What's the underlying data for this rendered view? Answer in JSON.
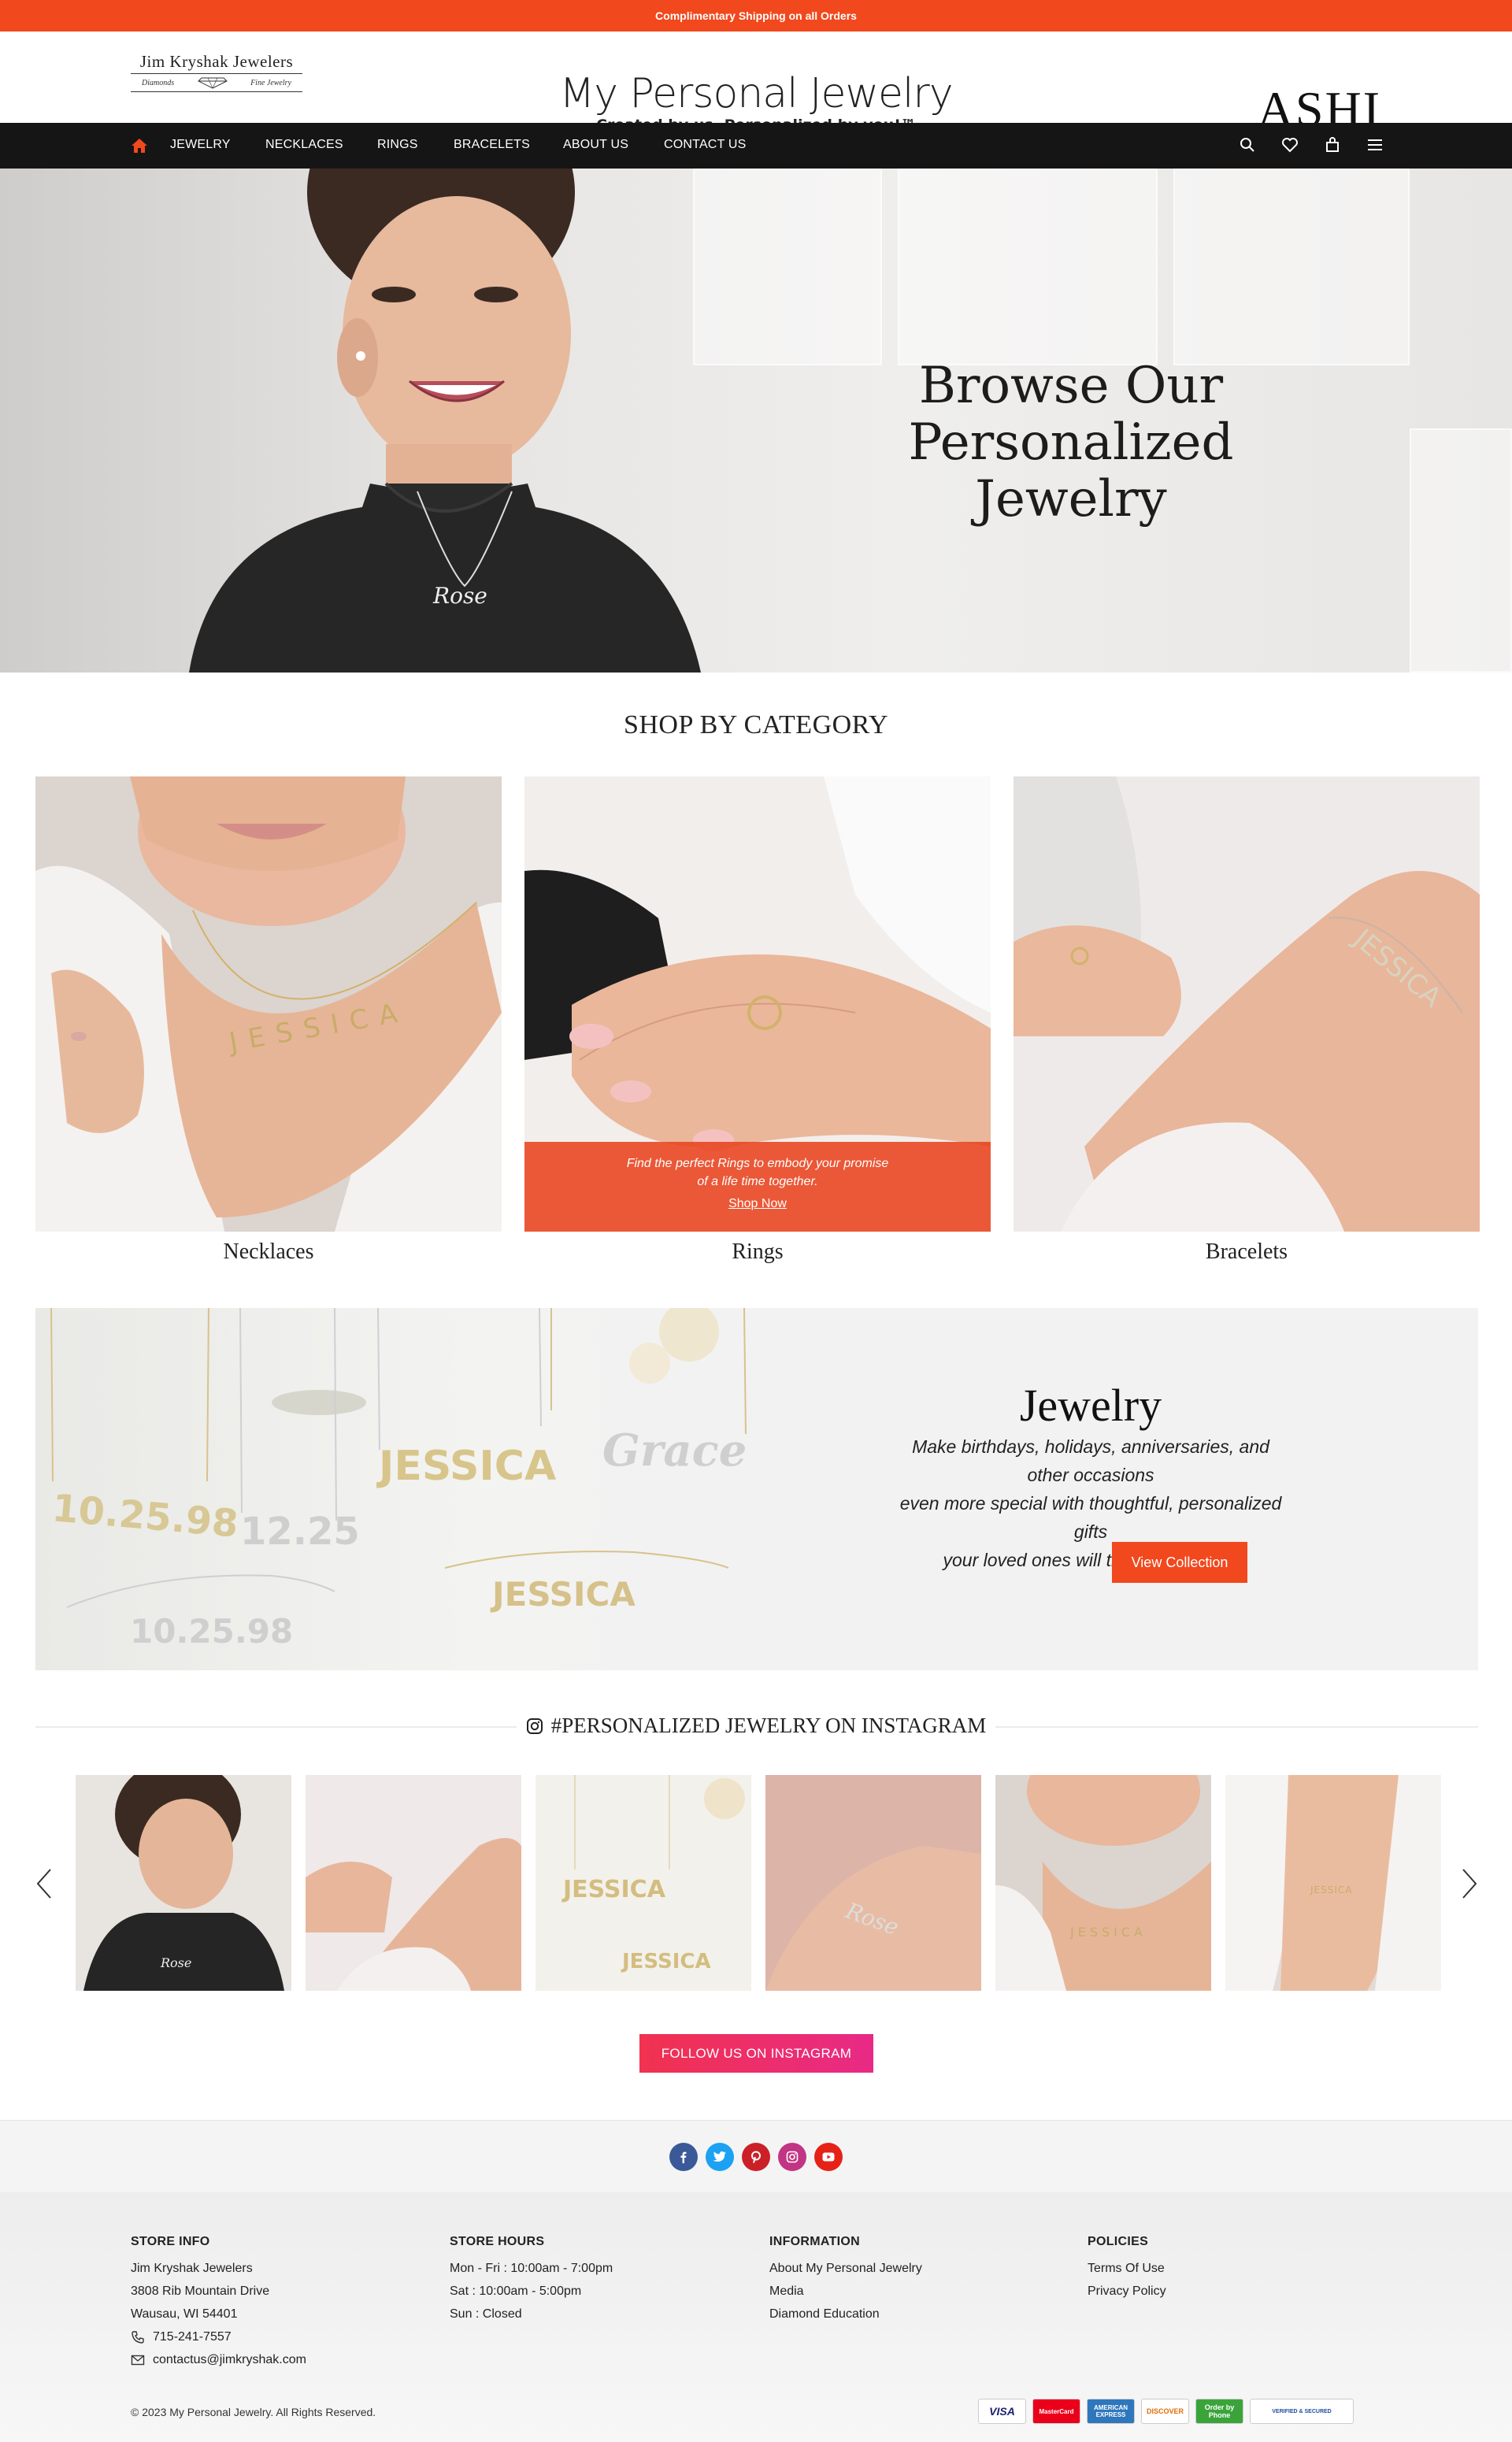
{
  "promo": {
    "text": "Complimentary Shipping on all Orders"
  },
  "header": {
    "jk_logo": {
      "name": "Jim Kryshak Jewelers",
      "left_sub": "Diamonds",
      "right_sub": "Fine Jewelry"
    },
    "mpj_logo": {
      "title": "My Personal Jewelry",
      "tagline": "Created by us, Personalized by you!™"
    },
    "ashi_logo": "ASHI"
  },
  "nav": {
    "items": [
      "JEWELRY",
      "NECKLACES",
      "RINGS",
      "BRACELETS",
      "ABOUT US",
      "CONTACT US"
    ],
    "icons": [
      "search-icon",
      "heart-icon",
      "bag-icon",
      "menu-icon"
    ]
  },
  "hero": {
    "title_line1": "Browse Our",
    "title_line2": "Personalized Jewelry",
    "necklace_text": "Rose"
  },
  "categories": {
    "title": "SHOP BY CATEGORY",
    "items": [
      {
        "label": "Necklaces",
        "name_on_item": "JESSICA"
      },
      {
        "label": "Rings",
        "overlay_text_1": "Find the perfect Rings to embody  your promise",
        "overlay_text_2": "of a life time together.",
        "overlay_link": "Shop Now"
      },
      {
        "label": "Bracelets",
        "name_on_item": "JESSICA"
      }
    ]
  },
  "collection": {
    "title": "Jewelry",
    "desc_1": "Make birthdays, holidays, anniversaries, and other occasions",
    "desc_2": "even more special with thoughtful, personalized gifts",
    "desc_3": "your loved ones will treasure forever.",
    "button": "View Collection",
    "pieces": [
      "10.25.98",
      "12.25",
      "JESSICA",
      "Grace",
      "JESSICA",
      "10.25.98"
    ]
  },
  "instagram": {
    "title": "#PERSONALIZED JEWELRY ON INSTAGRAM",
    "tile_texts": [
      "Rose",
      "",
      "JESSICA",
      "Rose",
      "JESSICA",
      "JESSICA"
    ],
    "follow_button": "FOLLOW US ON INSTAGRAM"
  },
  "social": [
    {
      "name": "facebook",
      "color": "#3b5998",
      "glyph": "f"
    },
    {
      "name": "twitter",
      "color": "#1da1f2",
      "glyph": "t"
    },
    {
      "name": "pinterest",
      "color": "#cb2027",
      "glyph": "p"
    },
    {
      "name": "instagram",
      "color": "#c13584",
      "glyph": "◎"
    },
    {
      "name": "youtube",
      "color": "#e62117",
      "glyph": "▶"
    }
  ],
  "footer": {
    "store_info": {
      "heading": "STORE INFO",
      "name": "Jim Kryshak Jewelers",
      "address1": "3808 Rib Mountain Drive",
      "address2": "Wausau, WI 54401",
      "phone": "715-241-7557",
      "email": "contactus@jimkryshak.com"
    },
    "store_hours": {
      "heading": "STORE HOURS",
      "weekdays": "Mon - Fri : 10:00am - 7:00pm",
      "saturday": "Sat : 10:00am - 5:00pm",
      "sunday": "Sun : Closed"
    },
    "information": {
      "heading": "INFORMATION",
      "links": [
        "About My Personal Jewelry",
        "Media",
        "Diamond Education"
      ]
    },
    "policies": {
      "heading": "POLICIES",
      "links": [
        "Terms Of Use",
        "Privacy Policy"
      ]
    },
    "copyright": "© 2023 My Personal Jewelry. All Rights Reserved.",
    "payments": [
      "VISA",
      "MasterCard",
      "AMERICAN EXPRESS",
      "DISCOVER",
      "Order by Phone",
      "VERIFIED & SECURED"
    ]
  }
}
